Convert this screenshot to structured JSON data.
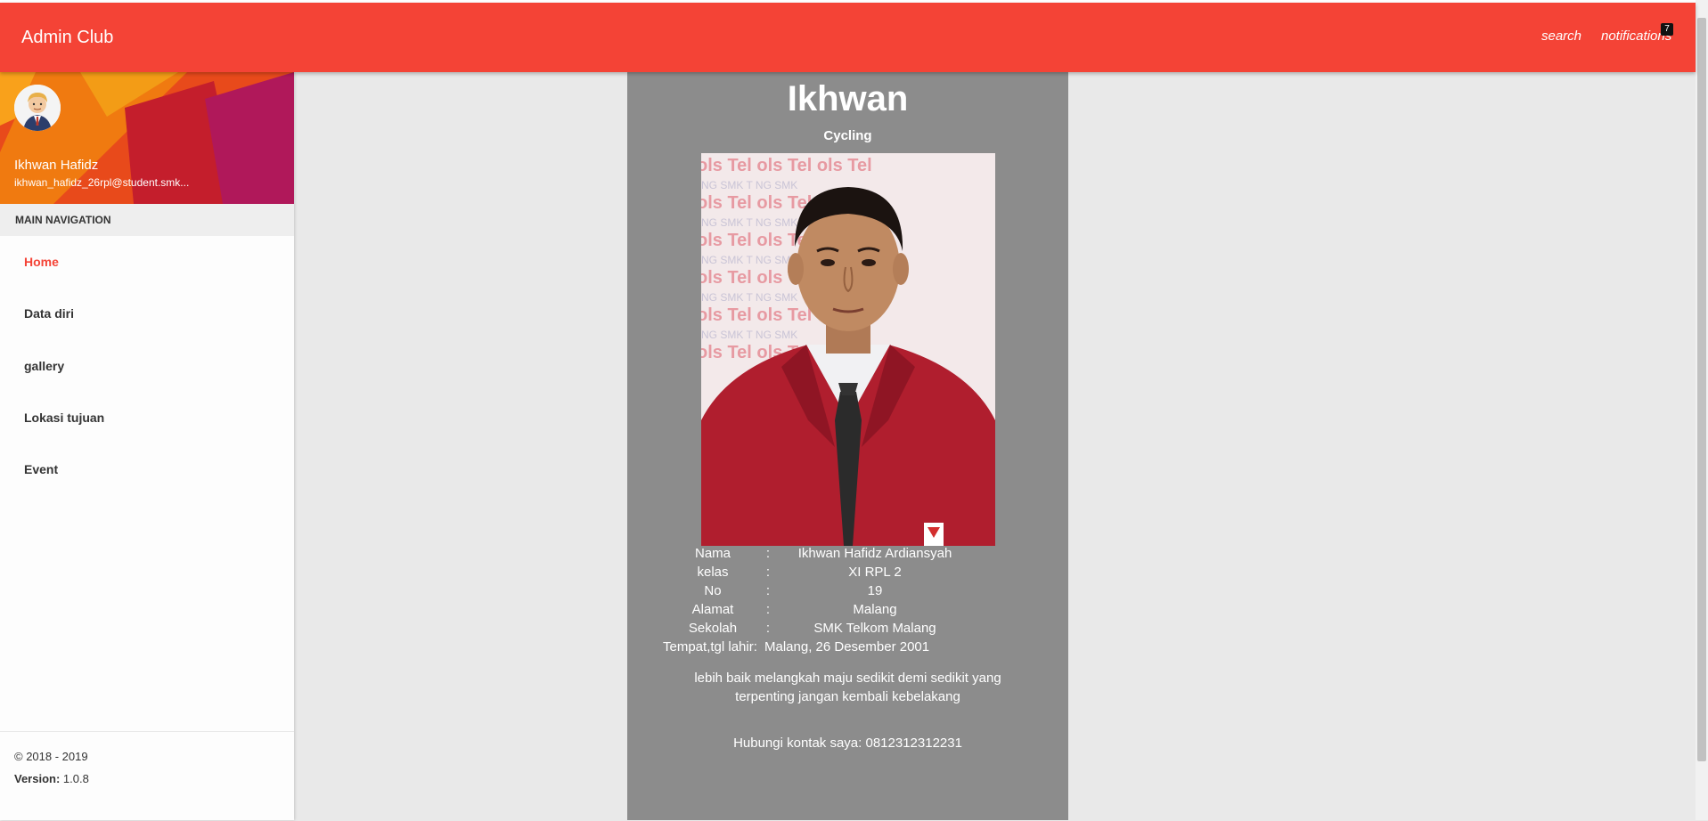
{
  "navbar": {
    "brand": "Admin Club",
    "search_label": "search",
    "notifications_label": "notifications",
    "notifications_count": "7"
  },
  "user": {
    "name": "Ikhwan Hafidz",
    "email": "ikhwan_hafidz_26rpl@student.smk..."
  },
  "menu": {
    "header": "MAIN NAVIGATION",
    "items": [
      {
        "label": "Home",
        "active": true
      },
      {
        "label": "Data diri",
        "active": false
      },
      {
        "label": "gallery",
        "active": false
      },
      {
        "label": "Lokasi tujuan",
        "active": false
      },
      {
        "label": "Event",
        "active": false
      }
    ]
  },
  "footer": {
    "copyright": "© 2018 - 2019",
    "version_label": "Version:",
    "version": "1.0.8"
  },
  "profile": {
    "title": "Ikhwan",
    "subtitle": "Cycling",
    "separator": ":",
    "rows": [
      {
        "label": "Nama",
        "value": "Ikhwan Hafidz Ardiansyah"
      },
      {
        "label": "kelas",
        "value": "XI RPL 2"
      },
      {
        "label": "No",
        "value": "19"
      },
      {
        "label": "Alamat",
        "value": "Malang"
      },
      {
        "label": "Sekolah",
        "value": "SMK Telkom Malang"
      },
      {
        "label": "Tempat,tgl lahir",
        "value": "Malang, 26 Desember 2001"
      }
    ],
    "quote": "lebih baik melangkah maju sedikit demi sedikit yang terpenting jangan kembali kebelakang",
    "contact": "Hubungi kontak saya: 0812312312231"
  },
  "colors": {
    "primary": "#f44336",
    "card_bg": "#8c8c8c",
    "content_bg": "#e9e9e9"
  }
}
